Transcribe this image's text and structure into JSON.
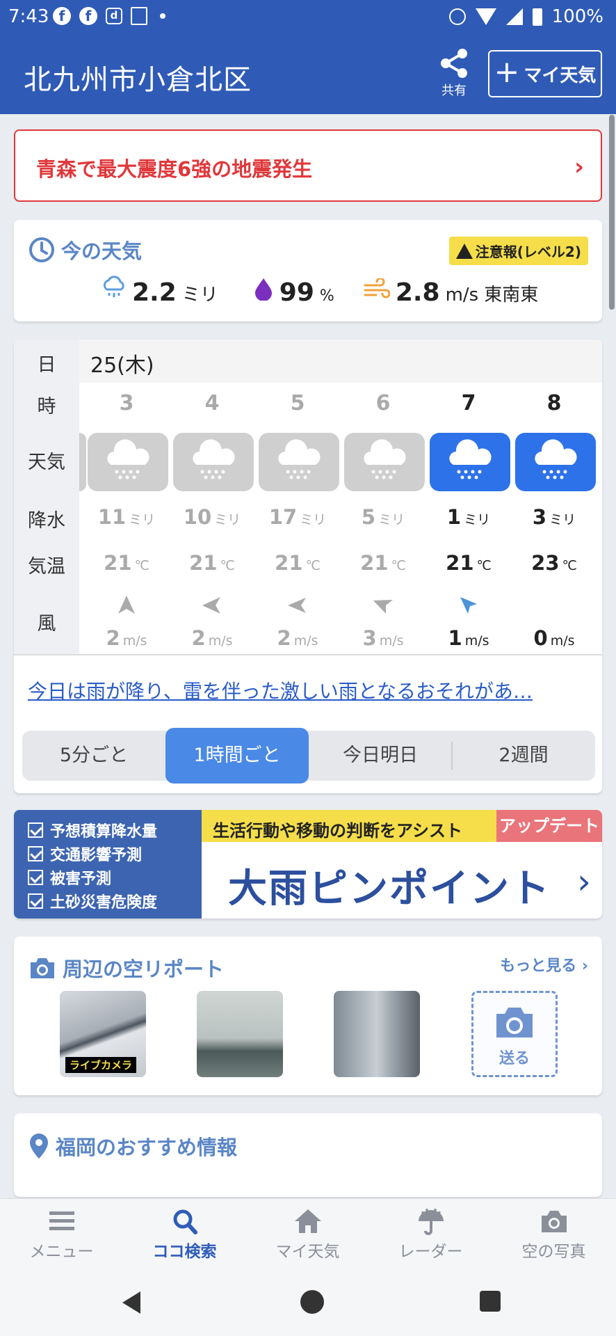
{
  "status_bar": {
    "time": "7:43",
    "fb1": "f",
    "fb2": "f",
    "d": "d",
    "battery": "100%"
  },
  "header": {
    "location": "北九州市小倉北区",
    "share_label": "共有",
    "my_weather_label": "マイ天気"
  },
  "alert": {
    "text": "青森で最大震度6強の地震発生"
  },
  "current": {
    "title": "今の天気",
    "warning": "注意報(レベル2)",
    "precip_value": "2.2",
    "precip_unit": "ミリ",
    "humidity_value": "99",
    "humidity_unit": "%",
    "wind_value": "2.8",
    "wind_unit": "m/s",
    "wind_dir": "東南東"
  },
  "hourly": {
    "labels": {
      "day": "日",
      "hour": "時",
      "weather": "天気",
      "precip": "降水",
      "temp": "気温",
      "wind": "風"
    },
    "date": "25(木)",
    "hours": [
      {
        "hour": "3",
        "rain": "11",
        "rain_unit": "ミリ",
        "temp": "21",
        "temp_unit": "℃",
        "wind": "2",
        "wind_unit": "m/s"
      },
      {
        "hour": "4",
        "rain": "10",
        "rain_unit": "ミリ",
        "temp": "21",
        "temp_unit": "℃",
        "wind": "2",
        "wind_unit": "m/s"
      },
      {
        "hour": "5",
        "rain": "17",
        "rain_unit": "ミリ",
        "temp": "21",
        "temp_unit": "℃",
        "wind": "2",
        "wind_unit": "m/s"
      },
      {
        "hour": "6",
        "rain": "5",
        "rain_unit": "ミリ",
        "temp": "21",
        "temp_unit": "℃",
        "wind": "3",
        "wind_unit": "m/s"
      },
      {
        "hour": "7",
        "rain": "1",
        "rain_unit": "ミリ",
        "temp": "21",
        "temp_unit": "℃",
        "wind": "1",
        "wind_unit": "m/s"
      },
      {
        "hour": "8",
        "rain": "3",
        "rain_unit": "ミリ",
        "temp": "23",
        "temp_unit": "℃",
        "wind": "0",
        "wind_unit": "m/s"
      }
    ],
    "forecast_link": "今日は雨が降り、雷を伴った激しい雨となるおそれがあ…",
    "tabs": [
      "5分ごと",
      "1時間ごと",
      "今日明日",
      "2週間"
    ]
  },
  "promo": {
    "items": [
      "予想積算降水量",
      "交通影響予測",
      "被害予測",
      "土砂災害危険度"
    ],
    "tagline": "生活行動や移動の判断をアシスト",
    "badge": "アップデート",
    "title": "大雨ピンポイント"
  },
  "sky_report": {
    "title": "周辺の空リポート",
    "more": "もっと見る",
    "live_label": "ライブカメラ",
    "send_label": "送る"
  },
  "recommend": {
    "title": "福岡のおすすめ情報"
  },
  "bottom_nav": [
    "メニュー",
    "ココ検索",
    "マイ天気",
    "レーダー",
    "空の写真"
  ],
  "colors": {
    "brand": "#2f5bb7",
    "accent": "#4a89e6",
    "alert": "#e0383b",
    "warning": "#f5de4a"
  }
}
